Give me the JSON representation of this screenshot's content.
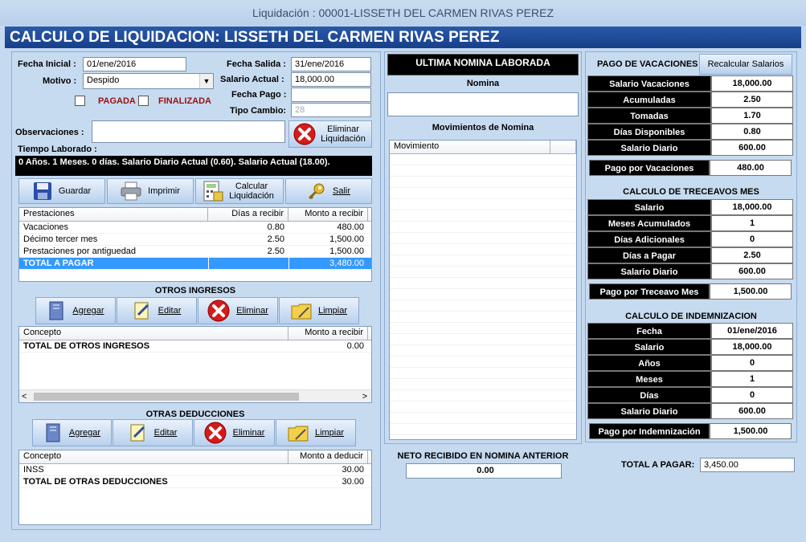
{
  "window": {
    "title": "Liquidación : 00001-LISSETH DEL CARMEN RIVAS PEREZ"
  },
  "banner": {
    "title": "CALCULO DE LIQUIDACION: LISSETH DEL CARMEN RIVAS PEREZ"
  },
  "form": {
    "fecha_inicial_label": "Fecha Inicial :",
    "fecha_inicial": "01/ene/2016",
    "motivo_label": "Motivo :",
    "motivo": "Despido",
    "pagada_label": "PAGADA",
    "finalizada_label": "FINALIZADA",
    "fecha_salida_label": "Fecha Salida :",
    "fecha_salida": "31/ene/2016",
    "salario_actual_label": "Salario Actual :",
    "salario_actual": "18,000.00",
    "fecha_pago_label": "Fecha Pago :",
    "fecha_pago": "",
    "tipo_cambio_label": "Tipo Cambio:",
    "tipo_cambio": "28",
    "observaciones_label": "Observaciones :",
    "observaciones": "",
    "eliminar_label": "Eliminar Liquidación",
    "tiempo_label": "Tiempo Laborado :",
    "tiempo_text": "0 Años. 1 Meses. 0 días. Salario Diario Actual (0.60). Salario Actual (18.00)."
  },
  "toolbar": {
    "guardar": "Guardar",
    "imprimir": "Imprimir",
    "calcular": "Calcular Liquidación",
    "salir": "Salir"
  },
  "prestaciones": {
    "headers": [
      "Prestaciones",
      "Días a recibir",
      "Monto a recibir"
    ],
    "rows": [
      [
        "Vacaciones",
        "0.80",
        "480.00"
      ],
      [
        "Décimo tercer mes",
        "2.50",
        "1,500.00"
      ],
      [
        "Prestaciones por antiguedad",
        "2.50",
        "1,500.00"
      ],
      [
        "TOTAL A PAGAR",
        "",
        "3,480.00"
      ]
    ]
  },
  "otros_ingresos": {
    "title": "OTROS INGRESOS",
    "buttons": {
      "agregar": "Agregar",
      "editar": "Editar",
      "eliminar": "Eliminar",
      "limpiar": "Limpiar"
    },
    "headers": [
      "Concepto",
      "Monto a recibir"
    ],
    "rows": [
      [
        "TOTAL DE OTROS INGRESOS",
        "0.00"
      ]
    ]
  },
  "otras_deducciones": {
    "title": "OTRAS DEDUCCIONES",
    "buttons": {
      "agregar": "Agregar",
      "editar": "Editar",
      "eliminar": "Eliminar",
      "limpiar": "Limpiar"
    },
    "headers": [
      "Concepto",
      "Monto a deducir"
    ],
    "rows": [
      [
        "INSS",
        "30.00"
      ],
      [
        "TOTAL DE OTRAS DEDUCCIONES",
        "30.00"
      ]
    ]
  },
  "nomina": {
    "header": "ULTIMA NOMINA LABORADA",
    "nomina_label": "Nomina",
    "nomina_value": "",
    "movimientos_label": "Movimientos de Nomina",
    "mov_headers": [
      "Movimiento",
      ""
    ],
    "neto_label": "NETO RECIBIDO EN NOMINA ANTERIOR",
    "neto_value": "0.00"
  },
  "vacaciones": {
    "title": "PAGO DE VACACIONES",
    "recalcular": "Recalcular Salarios",
    "rows": [
      [
        "Salario Vacaciones",
        "18,000.00"
      ],
      [
        "Acumuladas",
        "2.50"
      ],
      [
        "Tomadas",
        "1.70"
      ],
      [
        "Días Disponibles",
        "0.80"
      ],
      [
        "Salario Diario",
        "600.00"
      ]
    ],
    "total": [
      "Pago por Vacaciones",
      "480.00"
    ]
  },
  "treceavos": {
    "title": "CALCULO DE TRECEAVOS MES",
    "rows": [
      [
        "Salario",
        "18,000.00"
      ],
      [
        "Meses Acumulados",
        "1"
      ],
      [
        "Días Adicionales",
        "0"
      ],
      [
        "Días a Pagar",
        "2.50"
      ],
      [
        "Salario Diario",
        "600.00"
      ]
    ],
    "total": [
      "Pago por Treceavo Mes",
      "1,500.00"
    ]
  },
  "indemnizacion": {
    "title": "CALCULO DE INDEMNIZACION",
    "rows": [
      [
        "Fecha",
        "01/ene/2016"
      ],
      [
        "Salario",
        "18,000.00"
      ],
      [
        "Años",
        "0"
      ],
      [
        "Meses",
        "1"
      ],
      [
        "Días",
        "0"
      ],
      [
        "Salario Diario",
        "600.00"
      ]
    ],
    "total": [
      "Pago por Indemnización",
      "1,500.00"
    ]
  },
  "total_pagar": {
    "label": "TOTAL A PAGAR:",
    "value": "3,450.00"
  }
}
